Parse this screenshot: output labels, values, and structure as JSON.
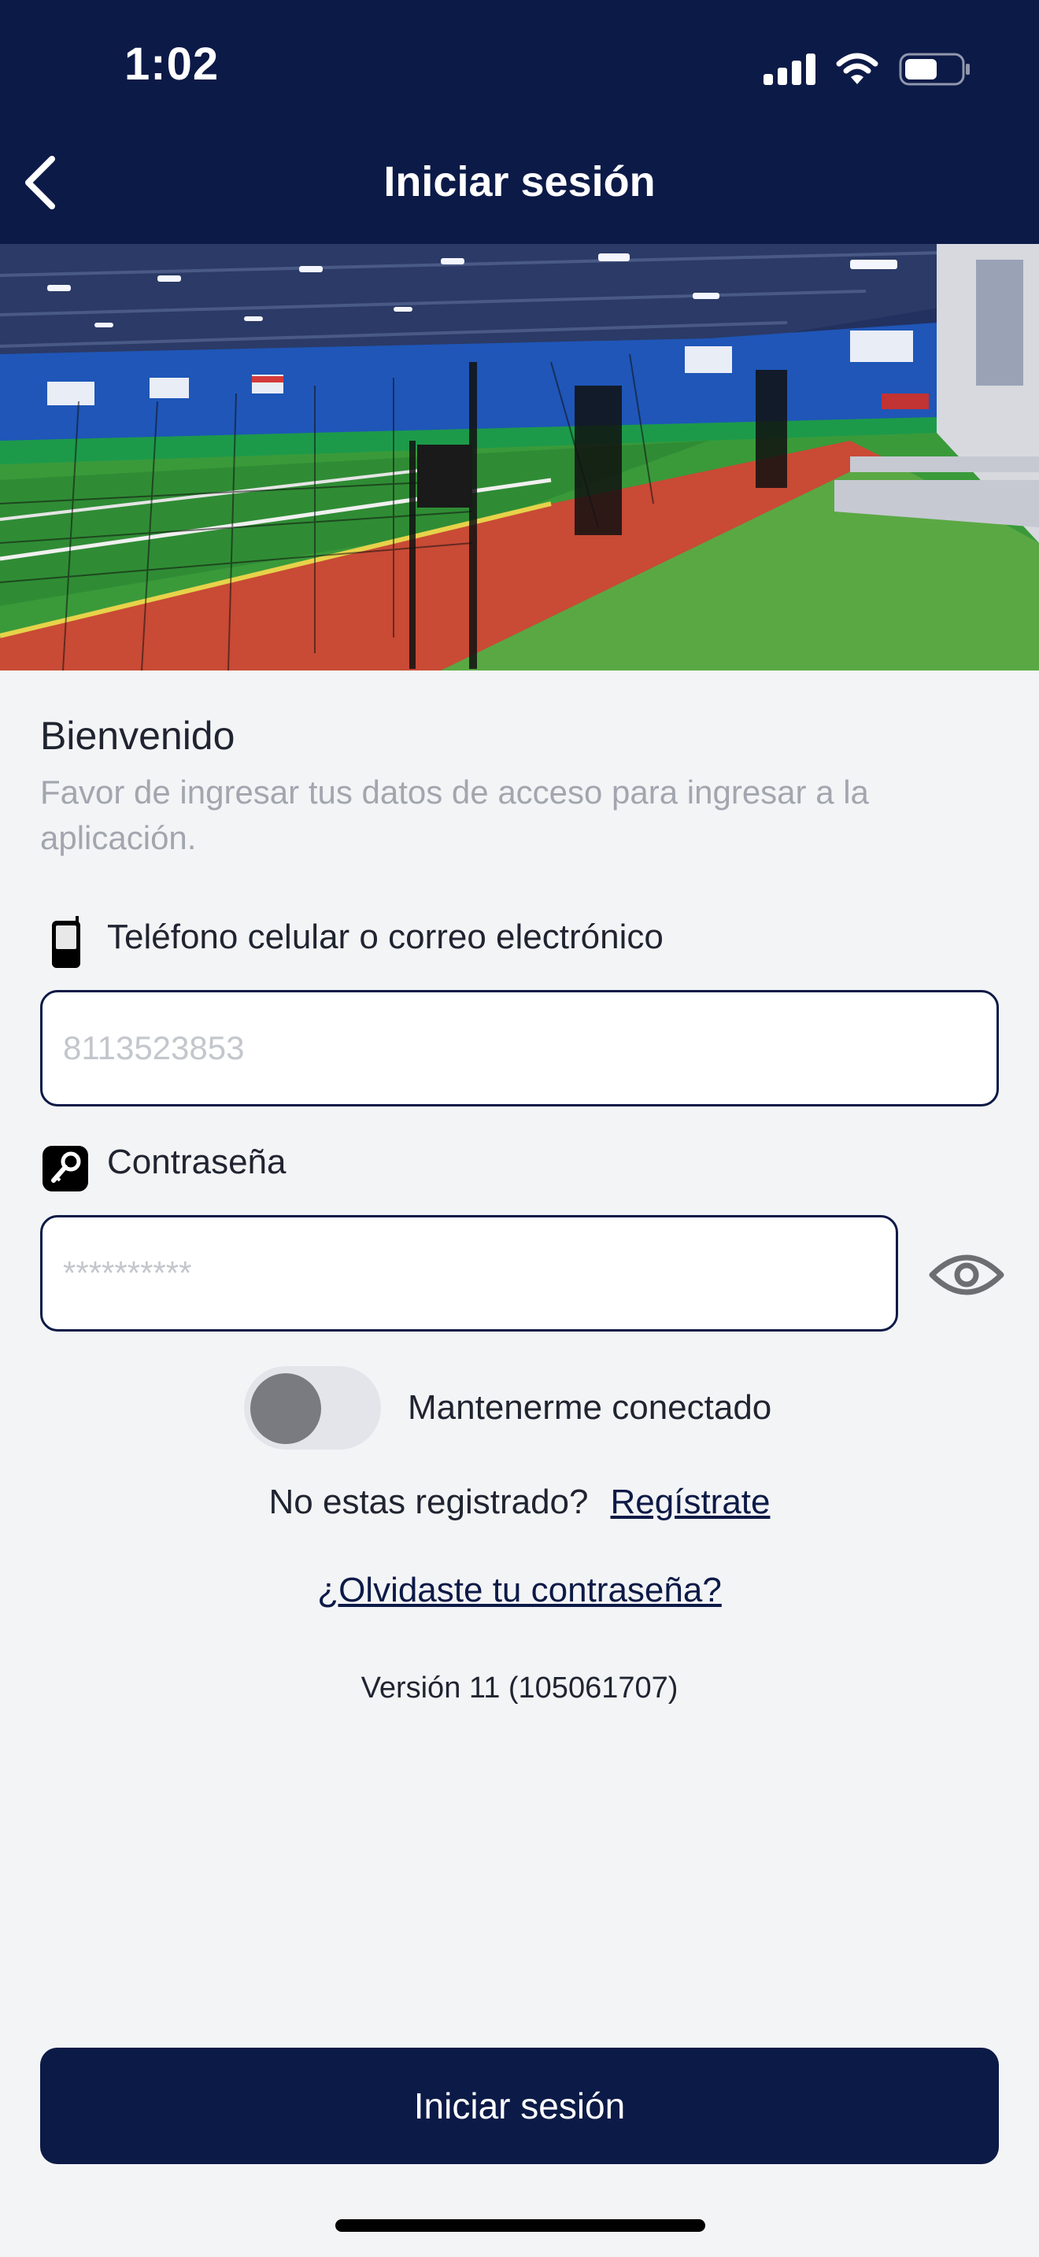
{
  "status_bar": {
    "time": "1:02",
    "icons": [
      "cellular-signal-icon",
      "wifi-icon",
      "battery-icon"
    ]
  },
  "nav": {
    "title": "Iniciar sesión",
    "back_icon": "chevron-left-icon"
  },
  "hero": {
    "image": "indoor-turf-batting-cage-photo"
  },
  "welcome": {
    "title": "Bienvenido",
    "subtitle": "Favor de ingresar tus datos de acceso para ingresar a la aplicación."
  },
  "phone_field": {
    "label": "Teléfono celular o correo electrónico",
    "placeholder": "8113523853",
    "icon": "mobile-phone-icon"
  },
  "password_field": {
    "label": "Contraseña",
    "placeholder": "**********",
    "icon": "key-icon",
    "toggle_icon": "eye-icon"
  },
  "stay_connected": {
    "label": "Mantenerme conectado",
    "on": false
  },
  "register": {
    "prompt": "No estas registrado?",
    "link": "Regístrate"
  },
  "forgot_password": "¿Olvidaste tu contraseña?",
  "version": "Versión 11 (105061707)",
  "submit_label": "Iniciar sesión",
  "colors": {
    "primary": "#0C1A47",
    "background": "#F3F4F6",
    "muted_text": "#A2A6AE"
  }
}
